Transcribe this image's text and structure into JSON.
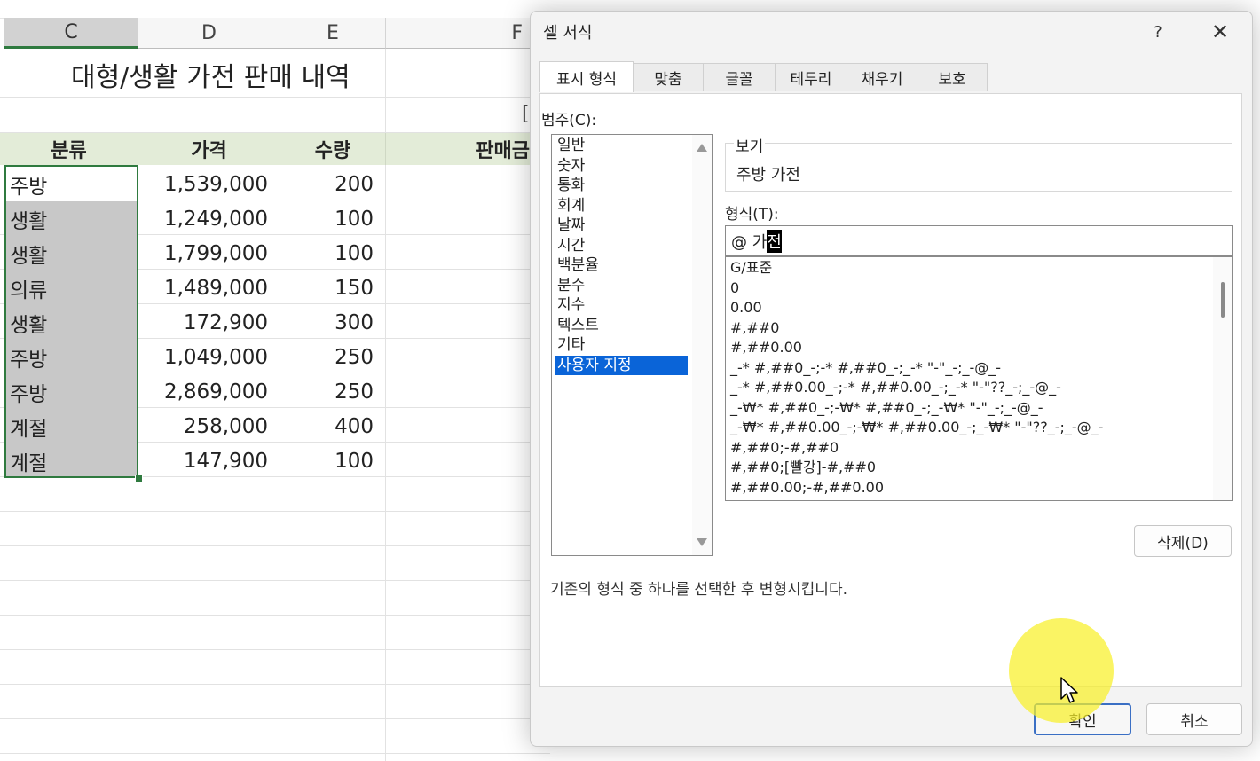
{
  "sheet": {
    "columns": [
      "C",
      "D",
      "E",
      "F"
    ],
    "title": "대형/생활 가전 판매 내역",
    "headers": [
      "분류",
      "가격",
      "수량",
      "판매금"
    ],
    "partial_cell": "[",
    "rows": [
      {
        "cat": "주방",
        "price": "1,539,000",
        "qty": "200"
      },
      {
        "cat": "생활",
        "price": "1,249,000",
        "qty": "100"
      },
      {
        "cat": "생활",
        "price": "1,799,000",
        "qty": "100"
      },
      {
        "cat": "의류",
        "price": "1,489,000",
        "qty": "150"
      },
      {
        "cat": "생활",
        "price": "172,900",
        "qty": "300"
      },
      {
        "cat": "주방",
        "price": "1,049,000",
        "qty": "250"
      },
      {
        "cat": "주방",
        "price": "2,869,000",
        "qty": "250"
      },
      {
        "cat": "계절",
        "price": "258,000",
        "qty": "400"
      },
      {
        "cat": "계절",
        "price": "147,900",
        "qty": "100"
      }
    ]
  },
  "dialog": {
    "title": "셀 서식",
    "help": "?",
    "close": "✕",
    "tabs": [
      "표시 형식",
      "맞춤",
      "글꼴",
      "테두리",
      "채우기",
      "보호"
    ],
    "category_label": "범주(C):",
    "categories": [
      "일반",
      "숫자",
      "통화",
      "회계",
      "날짜",
      "시간",
      "백분율",
      "분수",
      "지수",
      "텍스트",
      "기타",
      "사용자 지정"
    ],
    "selected_category": "사용자 지정",
    "preview_label": "보기",
    "preview_value": "주방 가전",
    "format_label": "형식(T):",
    "format_value_prefix": "@ 가",
    "format_value_caret": "전",
    "formats": [
      "G/표준",
      "0",
      "0.00",
      "#,##0",
      "#,##0.00",
      "_-* #,##0_-;-* #,##0_-;_-* \"-\"_-;_-@_-",
      "_-* #,##0.00_-;-* #,##0.00_-;_-* \"-\"??_-;_-@_-",
      "_-₩* #,##0_-;-₩* #,##0_-;_-₩* \"-\"_-;_-@_-",
      "_-₩* #,##0.00_-;-₩* #,##0.00_-;_-₩* \"-\"??_-;_-@_-",
      "#,##0;-#,##0",
      "#,##0;[빨강]-#,##0",
      "#,##0.00;-#,##0.00"
    ],
    "delete_label": "삭제(D)",
    "hint": "기존의 형식 중 하나를 선택한 후 변형시킵니다.",
    "ok_label": "확인",
    "cancel_label": "취소"
  }
}
